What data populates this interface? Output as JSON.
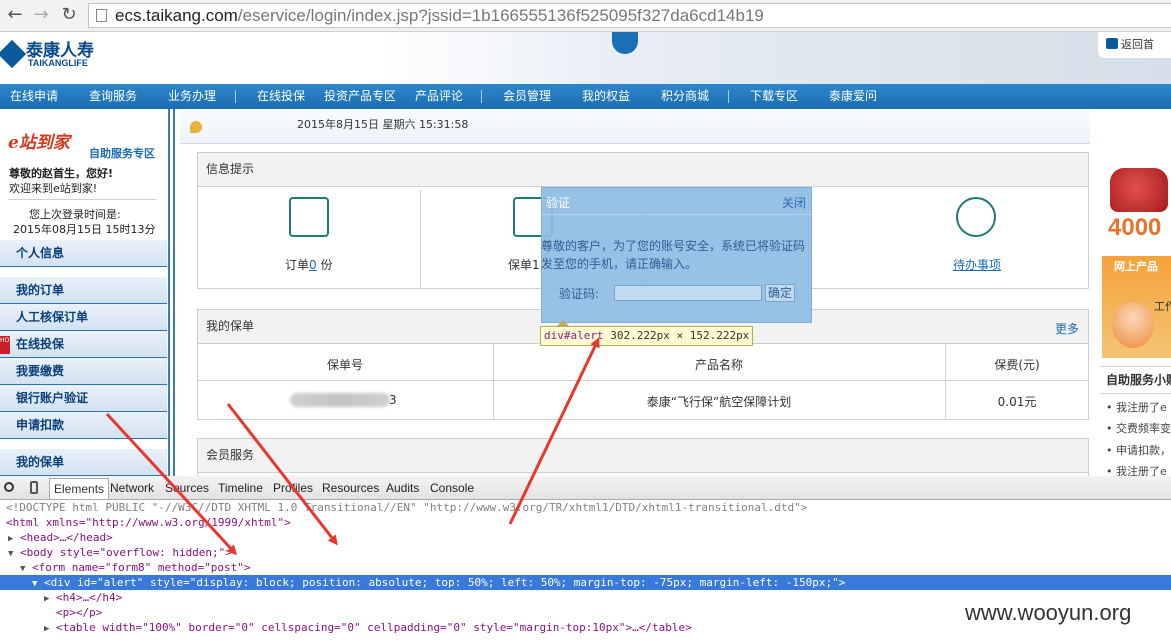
{
  "browser": {
    "url_domain": "ecs.taikang.com",
    "url_path": "/eservice/login/index.jsp?jssid=1b166555136f525095f327da6cd14b19"
  },
  "header": {
    "logo_cn": "泰康人寿",
    "logo_en": "TAIKANGLIFE",
    "home_link": "返回首"
  },
  "nav": {
    "items": [
      "在线申请",
      "查询服务",
      "业务办理",
      "在线投保",
      "投资产品专区",
      "产品评论",
      "会员管理",
      "我的权益",
      "积分商城",
      "下载专区",
      "泰康爱问"
    ]
  },
  "left": {
    "banner_title": "e站到家",
    "banner_subtitle": "自助服务专区",
    "greeting_1": "尊敬的赵首生，您好!",
    "greeting_2": "欢迎来到e站到家!",
    "last_login_label": "您上次登录时间是:",
    "last_login_value": "2015年08月15日  15时13分",
    "menu": [
      "个人信息",
      "我的订单",
      "人工核保订单",
      "在线投保",
      "我要缴费",
      "银行账户验证",
      "申请扣款",
      "我的保单"
    ],
    "hot_badge": "HOT"
  },
  "main": {
    "date_text": "2015年8月15日 星期六 15:31:58",
    "info_title": "信息提示",
    "info_orders_prefix": "订单",
    "info_orders_count": "0",
    "info_orders_suffix": " 份",
    "info_policies_label": "保单1",
    "info_todo_label": "待办事项",
    "policy_title": "我的保单",
    "policy_more": "更多",
    "policy_headers": [
      "保单号",
      "产品名称",
      "保费(元)"
    ],
    "policy_rows": [
      {
        "number_tail": "3",
        "product": "泰康“飞行保”航空保障计划",
        "premium": "0.01元"
      }
    ],
    "member_title": "会员服务"
  },
  "right": {
    "hotline": "4000",
    "online_title": "网上产品",
    "kefu_label": "工作",
    "selfsvc_title": "自助服务小贴",
    "items": [
      "我注册了e",
      "交费频率变",
      "申请扣款，",
      "我注册了e"
    ]
  },
  "dialog": {
    "title": "验证",
    "close": "关闭",
    "message_1": "尊敬的客户，为了您的账号安全，系统已将验证码",
    "message_2": "发至您的手机，请正确输入。",
    "code_label": "验证码:",
    "code_value": "",
    "ok_label": "确定"
  },
  "tooltip": {
    "tag": "div#alert",
    "size": "302.222px × 152.222px"
  },
  "devtools": {
    "tabs": [
      "Elements",
      "Network",
      "Sources",
      "Timeline",
      "Profiles",
      "Resources",
      "Audits",
      "Console"
    ],
    "lines": [
      "<!DOCTYPE html PUBLIC \"-//W3C//DTD XHTML 1.0 Transitional//EN\" \"http://www.w3.org/TR/xhtml1/DTD/xhtml1-transitional.dtd\">",
      "<html xmlns=\"http://www.w3.org/1999/xhtml\">",
      "<head>…</head>",
      "<body style=\"overflow: hidden;\">",
      "<form name=\"form8\" method=\"post\">",
      "<div id=\"alert\" style=\"display: block; position: absolute; top: 50%; left: 50%; margin-top: -75px; margin-left: -150px;\">",
      "<h4>…</h4>",
      "<p></p>",
      "<table width=\"100%\" border=\"0\" cellspacing=\"0\" cellpadding=\"0\" style=\"margin-top:10px\">…</table>"
    ]
  },
  "watermark": "www.wooyun.org",
  "colors": {
    "nav_blue": "#1b6cb0",
    "dialog_blue": "#8fbce4",
    "arrow_red": "#e8372c",
    "devtools_select": "#3879d9"
  }
}
